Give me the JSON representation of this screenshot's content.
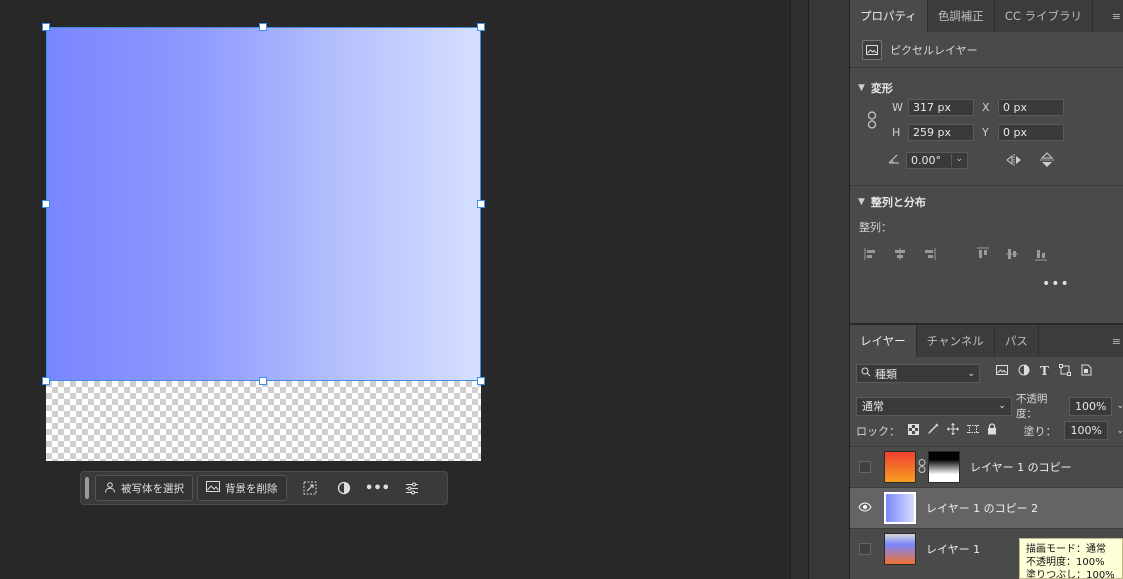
{
  "canvas": {
    "gradient_colors": [
      "#7a86fe",
      "#d5dfff"
    ]
  },
  "taskbar": {
    "select_subject_label": "被写体を選択",
    "remove_background_label": "背景を削除"
  },
  "properties": {
    "tabs": [
      "プロパティ",
      "色調補正",
      "CC ライブラリ"
    ],
    "kind": "ピクセルレイヤー",
    "transform": {
      "heading": "変形",
      "w_label": "W",
      "w_value": "317 px",
      "h_label": "H",
      "h_value": "259 px",
      "x_label": "X",
      "x_value": "0 px",
      "y_label": "Y",
      "y_value": "0 px",
      "angle_value": "0.00°"
    },
    "align": {
      "heading": "整列と分布",
      "label": "整列："
    }
  },
  "layers": {
    "tabs": [
      "レイヤー",
      "チャンネル",
      "パス"
    ],
    "filter_kind": "種類",
    "blend_mode": "通常",
    "opacity_label": "不透明度：",
    "opacity_value": "100%",
    "lock_label": "ロック：",
    "fill_label": "塗り：",
    "fill_value": "100%",
    "items": [
      {
        "name": "レイヤー 1 のコピー",
        "visible": false,
        "selected": false
      },
      {
        "name": "レイヤー 1 のコピー 2",
        "visible": true,
        "selected": true
      },
      {
        "name": "レイヤー 1",
        "visible": false,
        "selected": false
      }
    ]
  },
  "tooltip": {
    "line1": "描画モード：通常",
    "line2": "不透明度：100%",
    "line3": "塗りつぶし：100%"
  }
}
